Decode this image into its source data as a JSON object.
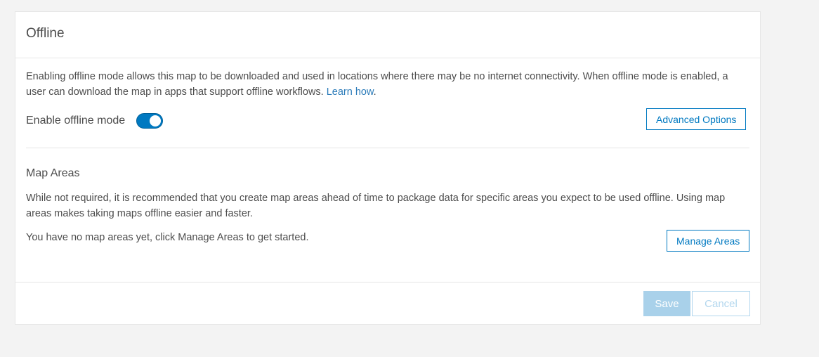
{
  "panel": {
    "title": "Offline"
  },
  "offline": {
    "description": "Enabling offline mode allows this map to be downloaded and used in locations where there may be no internet connectivity. When offline mode is enabled, a user can download the map in apps that support offline workflows.",
    "learn_link": "Learn how",
    "learn_suffix": ".",
    "toggle_label": "Enable offline mode",
    "toggle_on": true,
    "advanced_button": "Advanced Options"
  },
  "map_areas": {
    "title": "Map Areas",
    "description": "While not required, it is recommended that you create map areas ahead of time to package data for specific areas you expect to be used offline. Using map areas makes taking maps offline easier and faster.",
    "empty_text": "You have no map areas yet, click Manage Areas to get started.",
    "manage_button": "Manage Areas"
  },
  "footer": {
    "save_label": "Save",
    "cancel_label": "Cancel"
  },
  "colors": {
    "accent": "#0079c1",
    "link": "#2b7bb9",
    "disabled_primary": "#a9d1ea",
    "background": "#f3f3f3"
  }
}
